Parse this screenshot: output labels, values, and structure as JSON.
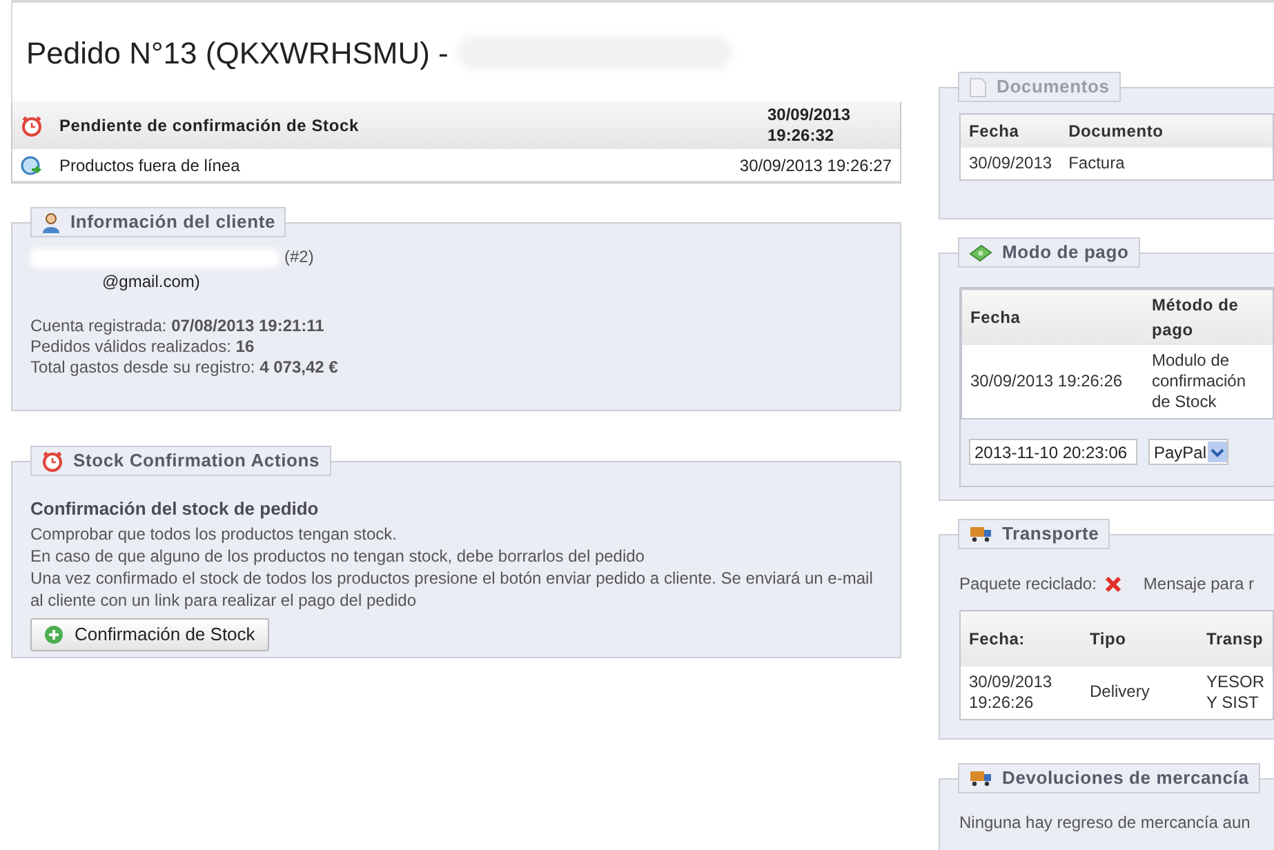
{
  "header": {
    "title": "Pedido N°13 (QKXWRHSMU) -"
  },
  "status_history": [
    {
      "kind": "pending",
      "label": "Pendiente de confirmación de Stock",
      "date": "30/09/2013 19:26:32",
      "current": true
    },
    {
      "kind": "discontinued",
      "label": "Productos fuera de línea",
      "date": "30/09/2013 19:26:27",
      "current": false
    }
  ],
  "customer": {
    "title": "Información del cliente",
    "id": "(#2)",
    "email": "@gmail.com)",
    "stats": [
      {
        "label": "Cuenta registrada:",
        "value": "07/08/2013 19:21:11"
      },
      {
        "label": "Pedidos válidos realizados:",
        "value": "16"
      },
      {
        "label": "Total gastos desde su registro:",
        "value": "4 073,42 €"
      }
    ]
  },
  "stock_actions": {
    "title": "Stock Confirmation Actions",
    "heading": "Confirmación del stock de pedido",
    "lines": [
      "Comprobar que todos los productos tengan stock.",
      "En caso de que alguno de los productos no tengan stock, debe borrarlos del pedido",
      "Una vez confirmado el stock de todos los productos presione el botón enviar pedido a cliente. Se enviará un e-mail al cliente con un link para realizar el pago del pedido"
    ],
    "button": "Confirmación de Stock"
  },
  "documents": {
    "title": "Documentos",
    "columns": [
      "Fecha",
      "Documento"
    ],
    "rows": [
      [
        "30/09/2013",
        "Factura"
      ]
    ]
  },
  "payment": {
    "title": "Modo de pago",
    "columns": [
      "Fecha",
      "Método de pago"
    ],
    "rows": [
      [
        "30/09/2013 19:26:26",
        "Modulo de confirmación de Stock"
      ]
    ],
    "date_value": "2013-11-10 20:23:06",
    "method_value": "PayPal"
  },
  "transport": {
    "title": "Transporte",
    "recycled_label": "Paquete reciclado:",
    "recycled": false,
    "message_label": "Mensaje para r",
    "columns": [
      "Fecha:",
      "Tipo",
      "Transp"
    ],
    "rows": [
      [
        "30/09/2013 19:26:26",
        "Delivery",
        "YESOR Y SIST"
      ]
    ]
  },
  "returns": {
    "title": "Devoluciones de mercancía",
    "message": "Ninguna hay regreso de mercancía aun"
  }
}
